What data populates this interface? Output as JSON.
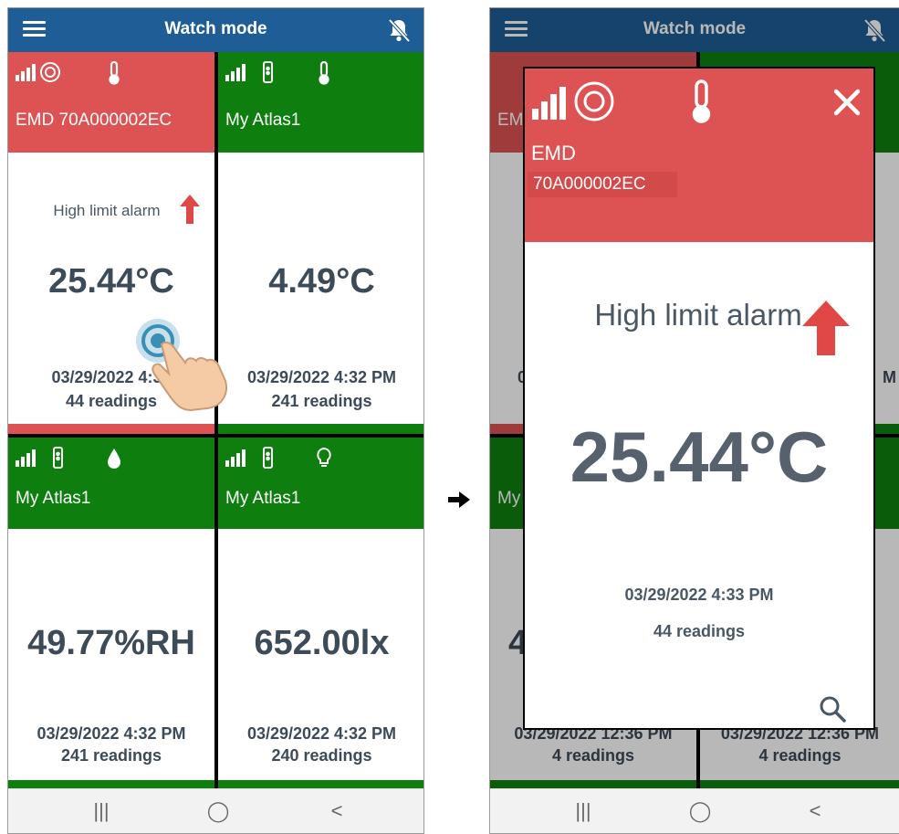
{
  "header": {
    "title": "Watch mode"
  },
  "tiles": [
    {
      "name": "EMD 70A000002EC",
      "alarm": "High limit alarm",
      "value": "25.44°C",
      "timestamp": "03/29/2022 4:33",
      "readings": "44 readings",
      "status_color": "#dd5252",
      "sensor_icon": "thermometer-icon",
      "device_icon": "emd-probe-icon"
    },
    {
      "name": "My Atlas1",
      "alarm": "",
      "value": "4.49°C",
      "timestamp": "03/29/2022 4:32 PM",
      "readings": "241 readings",
      "status_color": "#0e7e0e",
      "sensor_icon": "thermometer-icon",
      "device_icon": "atlas-logger-icon"
    },
    {
      "name": "My Atlas1",
      "alarm": "",
      "value": "49.77%RH",
      "timestamp": "03/29/2022 4:32 PM",
      "readings": "241 readings",
      "status_color": "#0e7e0e",
      "sensor_icon": "humidity-drop-icon",
      "device_icon": "atlas-logger-icon"
    },
    {
      "name": "My Atlas1",
      "alarm": "",
      "value": "652.00lx",
      "timestamp": "03/29/2022 4:32 PM",
      "readings": "240 readings",
      "status_color": "#0e7e0e",
      "sensor_icon": "light-bulb-icon",
      "device_icon": "atlas-logger-icon"
    }
  ],
  "background_tiles": {
    "left_header_fragment": "EM",
    "bottom_header_fragment": "My",
    "left_ts_fragment": "0",
    "right_ts_fragment": "M",
    "bottom_value_fragment": "4",
    "bottom_left_ts": "03/29/2022 12:36 PM",
    "bottom_left_readings": "4 readings",
    "bottom_right_ts": "03/29/2022 12:36 PM",
    "bottom_right_readings": "4 readings"
  },
  "modal": {
    "device_name": "EMD",
    "serial": "70A000002EC",
    "alarm": "High limit alarm",
    "value": "25.44°C",
    "timestamp": "03/29/2022 4:33 PM",
    "readings": "44 readings",
    "close_icon": "close-icon",
    "search_icon": "search-icon"
  },
  "navbar": {
    "recents": "|||",
    "home": "◯",
    "back": "<"
  },
  "colors": {
    "app_bar": "#1f5d96",
    "ok": "#0e7e0e",
    "alarm": "#dd5252",
    "value_text": "#3d4a58",
    "alarm_arrow": "#e04848"
  }
}
